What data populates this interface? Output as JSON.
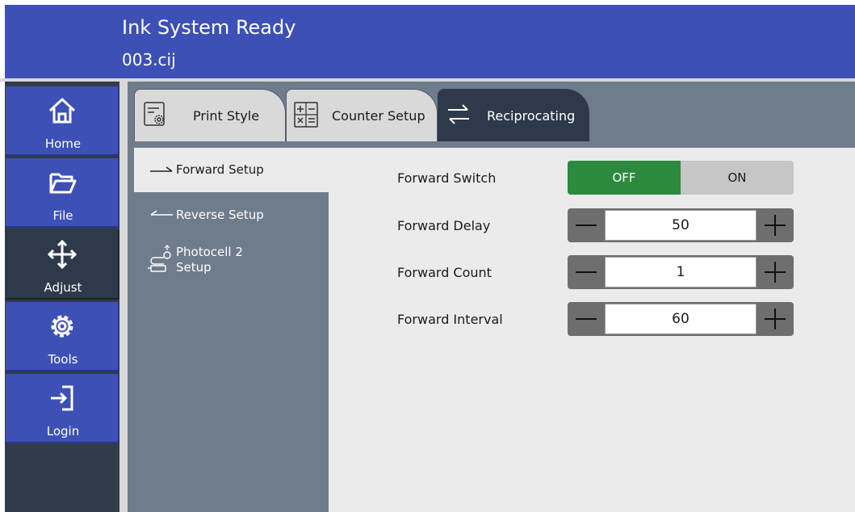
{
  "header": {
    "status": "Ink System Ready",
    "file": "003.cij"
  },
  "sidebar": {
    "items": [
      {
        "label": "Home",
        "icon": "home-icon"
      },
      {
        "label": "File",
        "icon": "folder-icon"
      },
      {
        "label": "Adjust",
        "icon": "move-icon"
      },
      {
        "label": "Tools",
        "icon": "gear-icon"
      },
      {
        "label": "Login",
        "icon": "login-icon"
      }
    ],
    "active": "Adjust"
  },
  "tabs": [
    {
      "label": "Print Style",
      "icon": "print-style-icon"
    },
    {
      "label": "Counter Setup",
      "icon": "calculator-icon"
    },
    {
      "label": "Reciprocating",
      "icon": "swap-arrows-icon"
    }
  ],
  "active_tab": "Reciprocating",
  "subnav": {
    "items": [
      {
        "label": "Forward Setup",
        "icon": "forward-arrow-icon"
      },
      {
        "label": "Reverse Setup",
        "icon": "reverse-arrow-icon"
      },
      {
        "label_line1": "Photocell 2",
        "label_line2": "Setup",
        "icon": "photocell-icon"
      }
    ],
    "active": "Forward Setup"
  },
  "settings": {
    "forward_switch": {
      "label": "Forward Switch",
      "off_label": "OFF",
      "on_label": "ON",
      "value": "OFF"
    },
    "forward_delay": {
      "label": "Forward Delay",
      "value": "50"
    },
    "forward_count": {
      "label": "Forward Count",
      "value": "1"
    },
    "forward_interval": {
      "label": "Forward Interval",
      "value": "60"
    }
  },
  "colors": {
    "header": "#3d50b6",
    "active_toggle": "#2c8a3f",
    "dark_panel": "#2e3a4b"
  }
}
